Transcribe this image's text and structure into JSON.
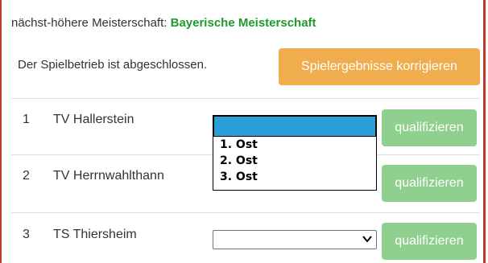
{
  "header": {
    "next_label": "nächst-höhere Meisterschaft:",
    "next_value": "Bayerische Meisterschaft"
  },
  "status": {
    "text": "Der Spielbetrieb ist abgeschlossen.",
    "correct_button": "Spielergebnisse korrigieren"
  },
  "teams": [
    {
      "rank": "1",
      "name": "TV Hallerstein",
      "select_value": "",
      "qualify_label": "qualifizieren"
    },
    {
      "rank": "2",
      "name": "TV Herrnwahlthann",
      "select_value": "",
      "qualify_label": "qualifizieren"
    },
    {
      "rank": "3",
      "name": "TS Thiersheim",
      "select_value": "",
      "qualify_label": "qualifizieren"
    }
  ],
  "dropdown": {
    "options": [
      "",
      "1. Ost",
      "2. Ost",
      "3. Ost"
    ]
  },
  "colors": {
    "border": "#c0392b",
    "champ_green": "#1f9a2b",
    "orange": "#f0ad4e",
    "qualify_green": "#8fd08f",
    "dropdown_highlight": "#2a9fd8"
  }
}
